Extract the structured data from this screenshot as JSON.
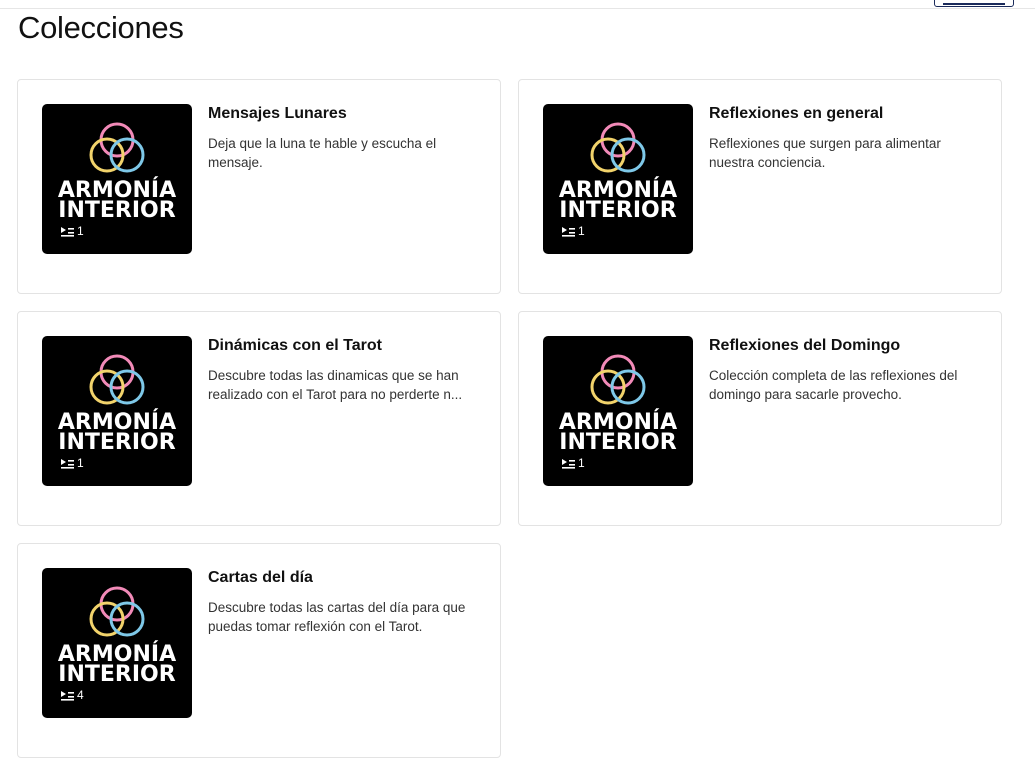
{
  "page": {
    "title": "Colecciones"
  },
  "collections": [
    {
      "title": "Mensajes Lunares",
      "description": "Deja que la luna te hable y escucha el mensaje.",
      "brand_line1": "ARMONÍA",
      "brand_line2": "INTERIOR",
      "count": "1"
    },
    {
      "title": "Reflexiones en general",
      "description": "Reflexiones que surgen para alimentar nuestra conciencia.",
      "brand_line1": "ARMONÍA",
      "brand_line2": "INTERIOR",
      "count": "1"
    },
    {
      "title": "Dinámicas con el Tarot",
      "description": "Descubre todas las dinamicas que se han realizado con el Tarot para no perderte n...",
      "brand_line1": "ARMONÍA",
      "brand_line2": "INTERIOR",
      "count": "1"
    },
    {
      "title": "Reflexiones del Domingo",
      "description": "Colección completa de las reflexiones del domingo para sacarle provecho.",
      "brand_line1": "ARMONÍA",
      "brand_line2": "INTERIOR",
      "count": "1"
    },
    {
      "title": "Cartas del día",
      "description": "Descubre todas las cartas del día para que puedas tomar reflexión con el Tarot.",
      "brand_line1": "ARMONÍA",
      "brand_line2": "INTERIOR",
      "count": "4"
    }
  ],
  "icons": {
    "logo": "overlapping-rings-logo-icon",
    "count": "playlist-icon"
  },
  "colors": {
    "ring_pink": "#f28ab8",
    "ring_yellow": "#f2d36b",
    "ring_blue": "#7ec8e8",
    "thumb_bg": "#000000",
    "accent_border": "#1a2a5a"
  }
}
